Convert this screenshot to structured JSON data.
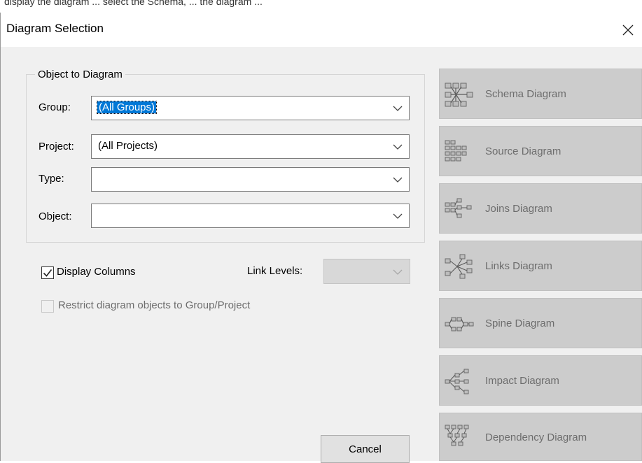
{
  "top_strip": {
    "text": "display the diagram ... select the Schema, ... the diagram ..."
  },
  "dialog": {
    "title": "Diagram Selection",
    "close_icon": "close-icon"
  },
  "object_group": {
    "title": "Object to Diagram",
    "fields": [
      {
        "label": "Group:",
        "value": "(All Groups)",
        "selected": true
      },
      {
        "label": "Project:",
        "value": "(All Projects)",
        "selected": false
      },
      {
        "label": "Type:",
        "value": "",
        "selected": false
      },
      {
        "label": "Object:",
        "value": "",
        "selected": false
      }
    ]
  },
  "options": {
    "display_columns_label": "Display Columns",
    "display_columns_checked": true,
    "link_levels_label": "Link Levels:",
    "link_levels_value": "",
    "link_levels_enabled": false,
    "restrict_label": "Restrict diagram objects to Group/Project",
    "restrict_checked": false,
    "restrict_enabled": false
  },
  "diagram_buttons": [
    {
      "label": "Schema Diagram",
      "icon": "schema-diagram-icon",
      "enabled": false
    },
    {
      "label": "Source Diagram",
      "icon": "source-diagram-icon",
      "enabled": false
    },
    {
      "label": "Joins Diagram",
      "icon": "joins-diagram-icon",
      "enabled": false
    },
    {
      "label": "Links Diagram",
      "icon": "links-diagram-icon",
      "enabled": false
    },
    {
      "label": "Spine Diagram",
      "icon": "spine-diagram-icon",
      "enabled": false
    },
    {
      "label": "Impact Diagram",
      "icon": "impact-diagram-icon",
      "enabled": false
    },
    {
      "label": "Dependency Diagram",
      "icon": "dependency-diagram-icon",
      "enabled": false
    }
  ],
  "buttons": {
    "cancel": "Cancel"
  },
  "colors": {
    "dialog_bg": "#f0f0f0",
    "selection": "#0078d7",
    "disabled_button": "#cccccc",
    "disabled_text": "#6d6d6d"
  }
}
